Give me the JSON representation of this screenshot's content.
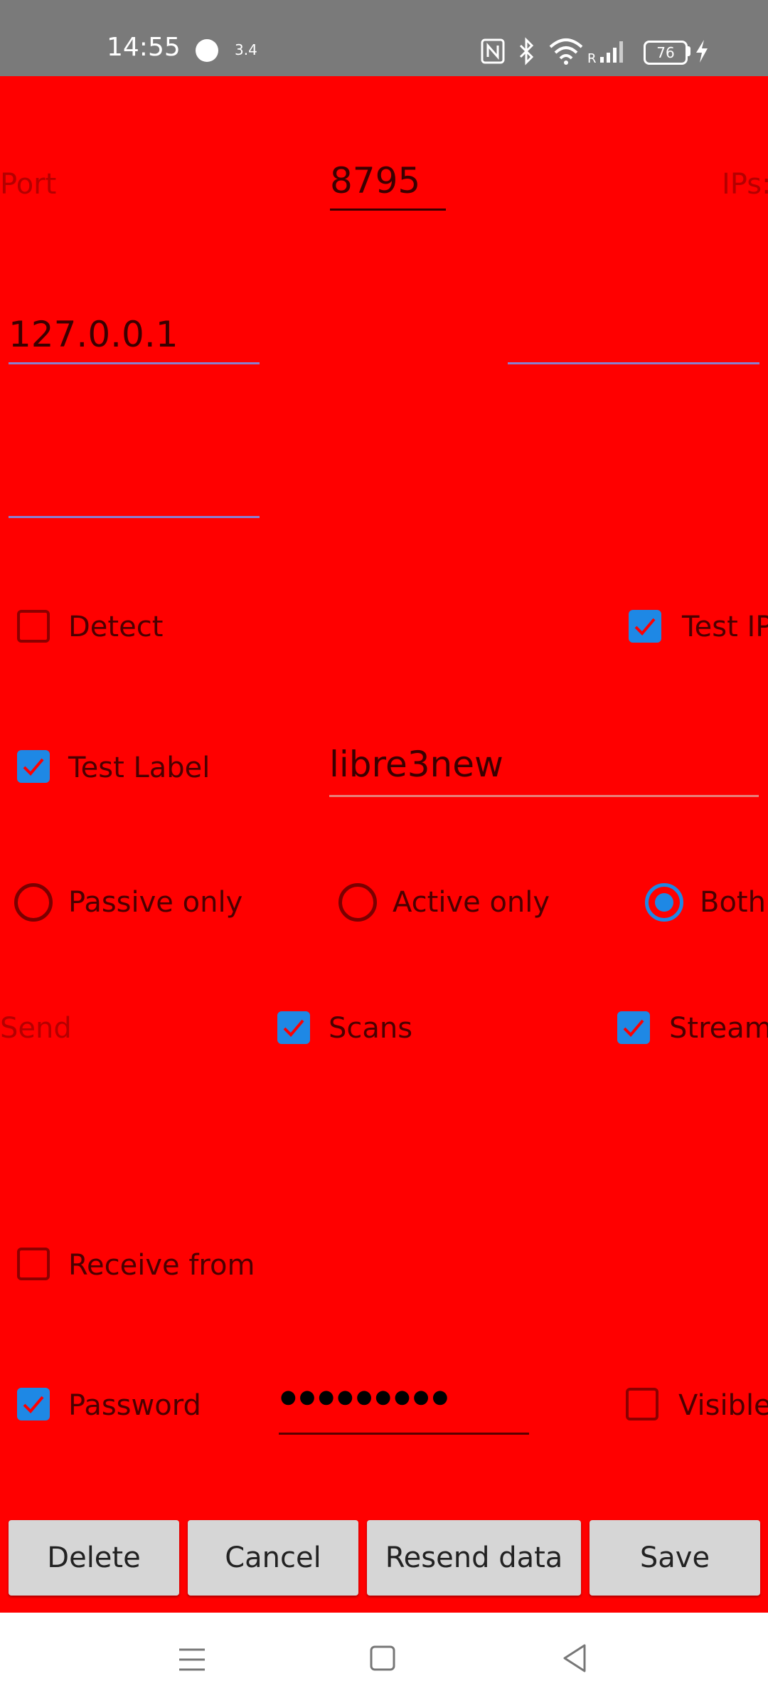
{
  "status_bar": {
    "time": "14:55",
    "network_speed": "3.4",
    "battery": "76"
  },
  "form": {
    "port_label": "Port",
    "port_value": "8795",
    "ips_label": "IPs:",
    "ip1_value": "127.0.0.1",
    "ip2_value": "",
    "ip3_value": "",
    "detect_label": "Detect",
    "detect_checked": false,
    "test_ip_label": "Test IP",
    "test_ip_checked": true,
    "test_label_label": "Test Label",
    "test_label_checked": true,
    "test_label_value": "libre3new",
    "mode_options": [
      {
        "label": "Passive only",
        "selected": false
      },
      {
        "label": "Active only",
        "selected": false
      },
      {
        "label": "Both",
        "selected": true
      }
    ],
    "send_label": "Send",
    "scans_label": "Scans",
    "scans_checked": true,
    "streams_label": "Stream",
    "streams_checked": true,
    "receive_from_label": "Receive from",
    "receive_from_checked": false,
    "password_label": "Password",
    "password_checked": true,
    "password_value": "●●●●●●●●●",
    "visible_label": "Visible",
    "visible_checked": false
  },
  "buttons": {
    "delete": "Delete",
    "cancel": "Cancel",
    "resend": "Resend data",
    "save": "Save"
  },
  "colors": {
    "background": "#ff0000",
    "accent": "#1e88e5",
    "status_bar": "#7a7a7a"
  },
  "icons": [
    "nfc-icon",
    "bluetooth-icon",
    "wifi-icon",
    "signal-icon",
    "battery-icon",
    "charging-icon",
    "menu-icon",
    "home-icon",
    "back-icon"
  ]
}
